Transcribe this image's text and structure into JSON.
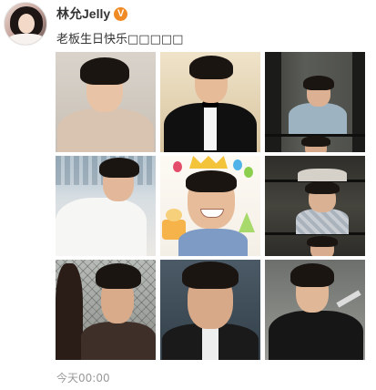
{
  "post": {
    "username": "林允Jelly",
    "verified_badge": "V",
    "text": "老板生日快乐□□□□□",
    "timestamp": "今天00:00"
  },
  "colors": {
    "username": "#333333",
    "timestamp": "#999999",
    "verified_badge": "#f08a24"
  },
  "photos": [
    {
      "name": "photo-1"
    },
    {
      "name": "photo-2"
    },
    {
      "name": "photo-3"
    },
    {
      "name": "photo-4"
    },
    {
      "name": "photo-5"
    },
    {
      "name": "photo-6"
    },
    {
      "name": "photo-7"
    },
    {
      "name": "photo-8"
    },
    {
      "name": "photo-9"
    }
  ]
}
